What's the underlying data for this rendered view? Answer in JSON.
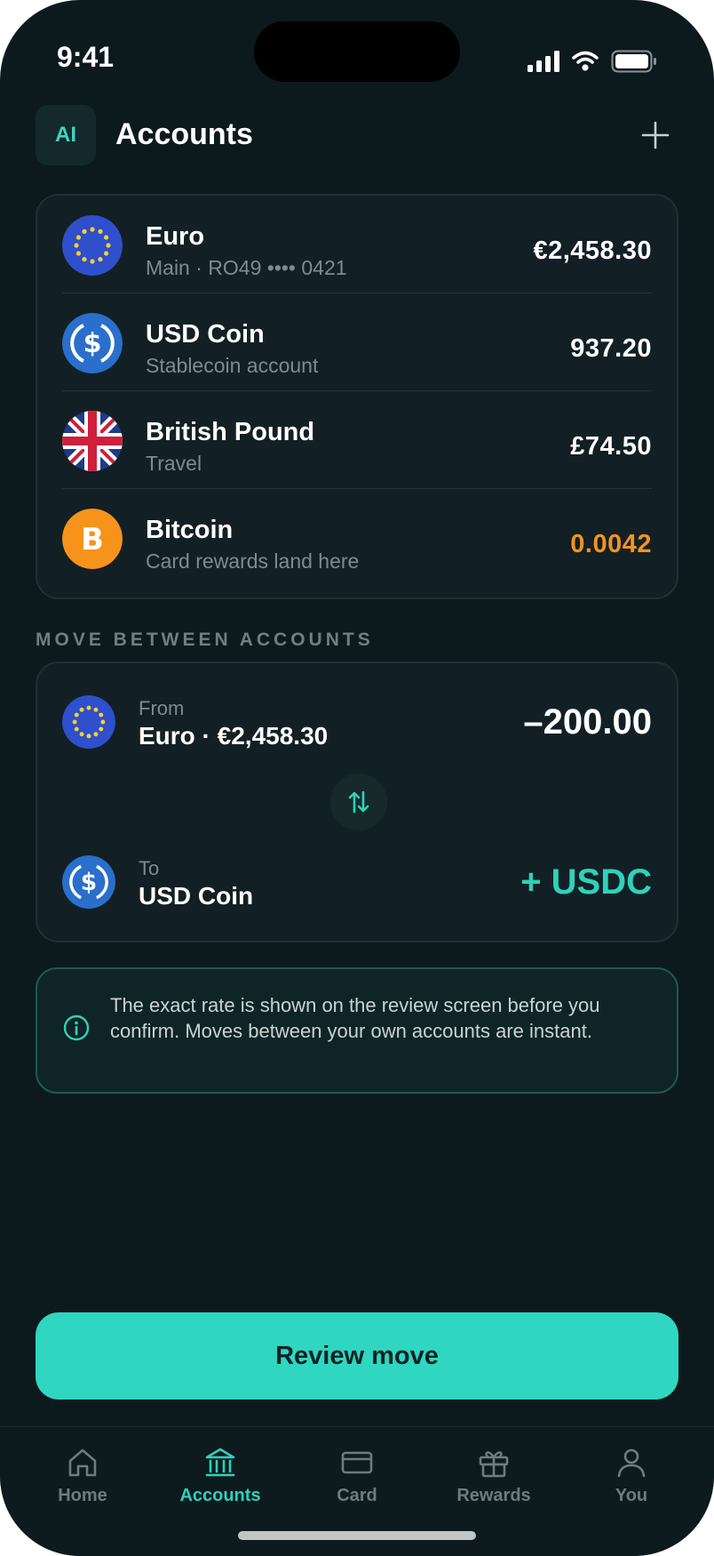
{
  "status_bar": {
    "time": "9:41"
  },
  "header": {
    "avatar_initials": "AI",
    "title": "Accounts"
  },
  "accounts": [
    {
      "name": "Euro",
      "subtitle": "Main · RO49 •••• 0421",
      "amount": "€2,458.30",
      "icon": "eu-flag-icon"
    },
    {
      "name": "USD Coin",
      "subtitle": "Stablecoin account",
      "amount": "937.20",
      "icon": "usdc-icon"
    },
    {
      "name": "British Pound",
      "subtitle": "Travel",
      "amount": "£74.50",
      "icon": "uk-flag-icon"
    },
    {
      "name": "Bitcoin",
      "subtitle": "Card rewards land here",
      "amount": "0.0042",
      "icon": "bitcoin-icon",
      "amount_color": "#f2941c"
    }
  ],
  "move": {
    "section_label": "MOVE BETWEEN ACCOUNTS",
    "from_label": "From",
    "from_value": "Euro · €2,458.30",
    "from_amount": "–200.00",
    "to_label": "To",
    "to_value": "USD Coin",
    "to_amount": "+ USDC"
  },
  "info": {
    "text": "The exact rate is shown on the review screen before you confirm. Moves between your own accounts are instant."
  },
  "cta": {
    "label": "Review move"
  },
  "tabs": [
    {
      "label": "Home",
      "icon": "home-icon",
      "active": false
    },
    {
      "label": "Accounts",
      "icon": "bank-icon",
      "active": true
    },
    {
      "label": "Card",
      "icon": "card-icon",
      "active": false
    },
    {
      "label": "Rewards",
      "icon": "gift-icon",
      "active": false
    },
    {
      "label": "You",
      "icon": "user-icon",
      "active": false
    }
  ],
  "colors": {
    "accent": "#2fd1bb",
    "bitcoin": "#f2941c",
    "background": "#0c1a1d",
    "card": "#122025"
  }
}
